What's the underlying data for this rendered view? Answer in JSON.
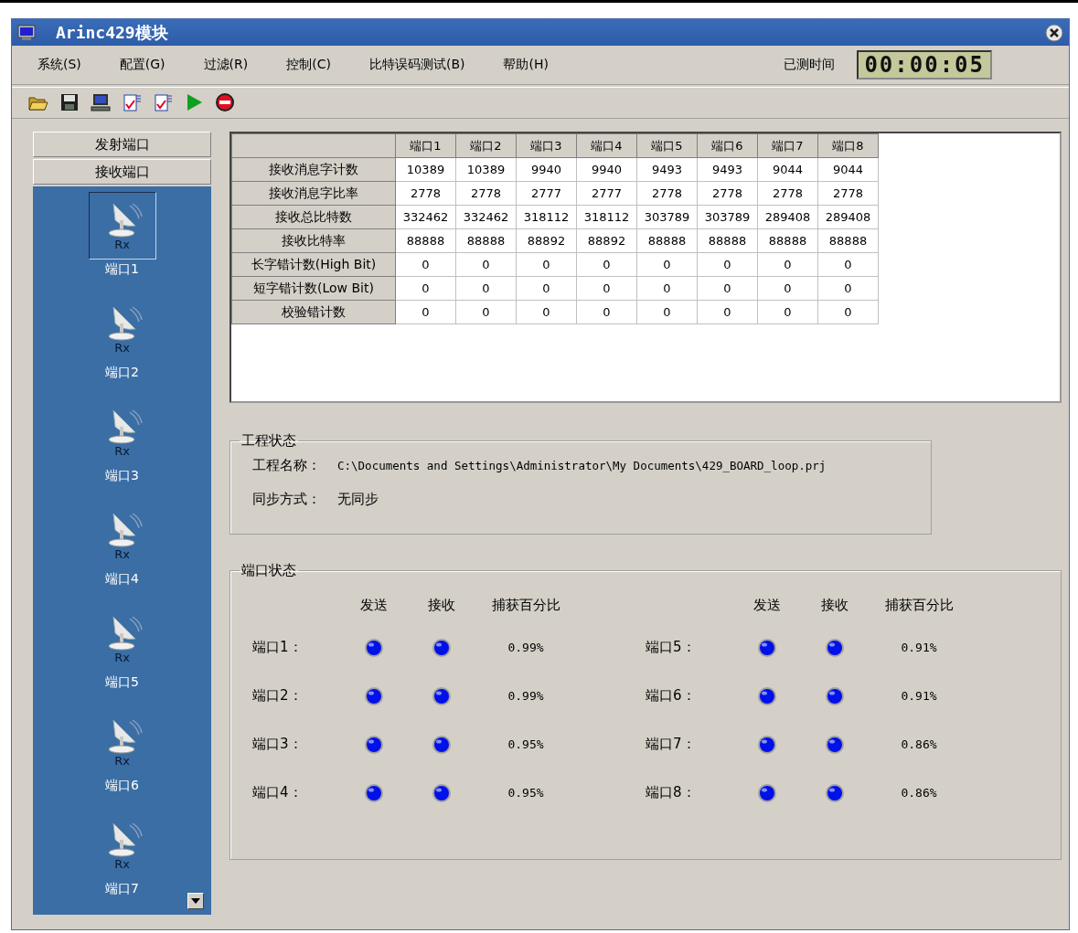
{
  "window": {
    "title": "Arinc429模块"
  },
  "menu": [
    "系统(S)",
    "配置(G)",
    "过滤(R)",
    "控制(C)",
    "比特误码测试(B)",
    "帮助(H)"
  ],
  "timer": {
    "label": "已测时间",
    "value": "00:00:05"
  },
  "toolbar": [
    {
      "kind": "open"
    },
    {
      "kind": "save"
    },
    {
      "kind": "computer"
    },
    {
      "kind": "rxdoc"
    },
    {
      "kind": "txdoc"
    },
    {
      "kind": "play"
    },
    {
      "kind": "stop"
    }
  ],
  "sidebar": {
    "sections": [
      "发射端口",
      "接收端口"
    ],
    "items": [
      {
        "label": "端口1",
        "badge": "Rx",
        "selected": true
      },
      {
        "label": "端口2",
        "badge": "Rx",
        "selected": false
      },
      {
        "label": "端口3",
        "badge": "Rx",
        "selected": false
      },
      {
        "label": "端口4",
        "badge": "Rx",
        "selected": false
      },
      {
        "label": "端口5",
        "badge": "Rx",
        "selected": false
      },
      {
        "label": "端口6",
        "badge": "Rx",
        "selected": false
      },
      {
        "label": "端口7",
        "badge": "Rx",
        "selected": false
      }
    ]
  },
  "table": {
    "columns": [
      "端口1",
      "端口2",
      "端口3",
      "端口4",
      "端口5",
      "端口6",
      "端口7",
      "端口8"
    ],
    "rows": [
      {
        "label": "接收消息字计数",
        "cells": [
          "10389",
          "10389",
          "9940",
          "9940",
          "9493",
          "9493",
          "9044",
          "9044"
        ]
      },
      {
        "label": "接收消息字比率",
        "cells": [
          "2778",
          "2778",
          "2777",
          "2777",
          "2778",
          "2778",
          "2778",
          "2778"
        ]
      },
      {
        "label": "接收总比特数",
        "cells": [
          "332462",
          "332462",
          "318112",
          "318112",
          "303789",
          "303789",
          "289408",
          "289408"
        ]
      },
      {
        "label": "接收比特率",
        "cells": [
          "88888",
          "88888",
          "88892",
          "88892",
          "88888",
          "88888",
          "88888",
          "88888"
        ]
      },
      {
        "label": "长字错计数(High Bit)",
        "cells": [
          "0",
          "0",
          "0",
          "0",
          "0",
          "0",
          "0",
          "0"
        ]
      },
      {
        "label": "短字错计数(Low Bit)",
        "cells": [
          "0",
          "0",
          "0",
          "0",
          "0",
          "0",
          "0",
          "0"
        ]
      },
      {
        "label": "校验错计数",
        "cells": [
          "0",
          "0",
          "0",
          "0",
          "0",
          "0",
          "0",
          "0"
        ]
      }
    ]
  },
  "project": {
    "title": "工程状态",
    "fields": [
      {
        "label": "工程名称：",
        "value": "C:\\Documents and Settings\\Administrator\\My Documents\\429_BOARD_loop.prj"
      },
      {
        "label": "同步方式：",
        "value": "无同步"
      }
    ]
  },
  "ports": {
    "title": "端口状态",
    "columns": [
      {
        "headers": [
          "发送",
          "接收",
          "捕获百分比"
        ],
        "rows": [
          {
            "label": "端口1：",
            "send": true,
            "receive": true,
            "percent": "0.99%"
          },
          {
            "label": "端口2：",
            "send": true,
            "receive": true,
            "percent": "0.99%"
          },
          {
            "label": "端口3：",
            "send": true,
            "receive": true,
            "percent": "0.95%"
          },
          {
            "label": "端口4：",
            "send": true,
            "receive": true,
            "percent": "0.95%"
          }
        ]
      },
      {
        "headers": [
          "发送",
          "接收",
          "捕获百分比"
        ],
        "rows": [
          {
            "label": "端口5：",
            "send": true,
            "receive": true,
            "percent": "0.91%"
          },
          {
            "label": "端口6：",
            "send": true,
            "receive": true,
            "percent": "0.91%"
          },
          {
            "label": "端口7：",
            "send": true,
            "receive": true,
            "percent": "0.86%"
          },
          {
            "label": "端口8：",
            "send": true,
            "receive": true,
            "percent": "0.86%"
          }
        ]
      }
    ]
  }
}
